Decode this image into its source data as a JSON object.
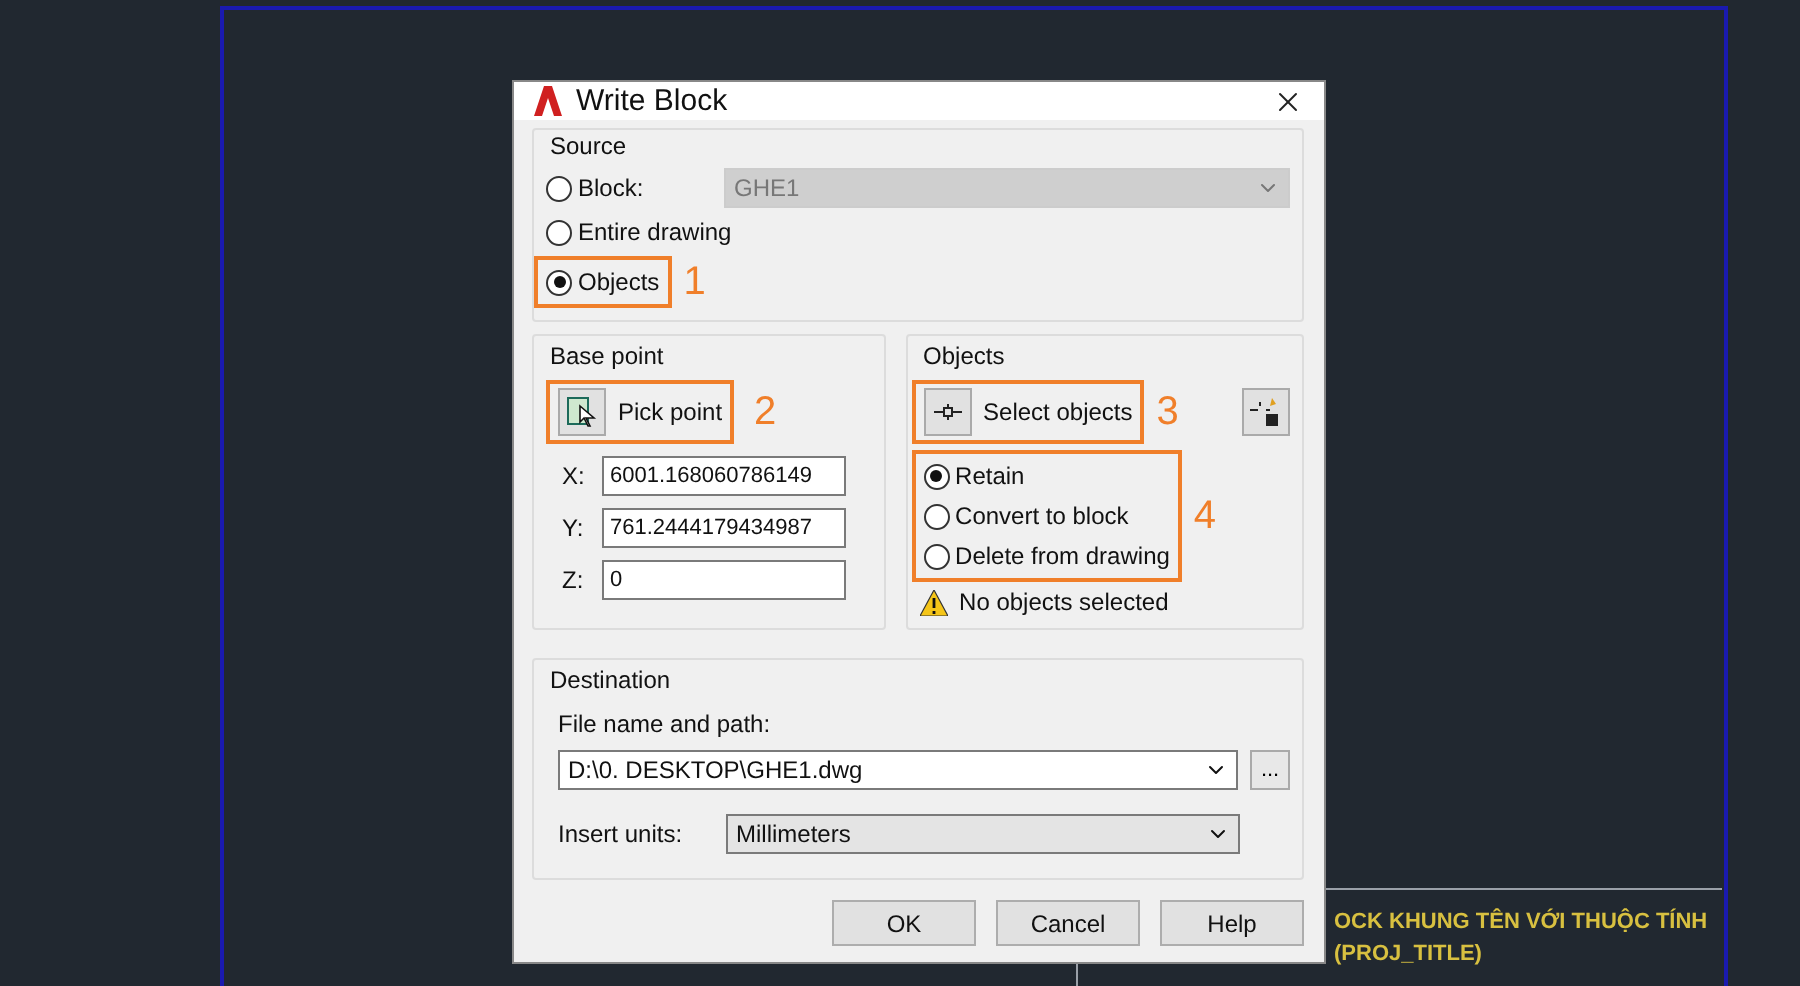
{
  "window": {
    "title": "Write Block"
  },
  "source": {
    "legend": "Source",
    "options": [
      {
        "label": "Block:",
        "selected": false
      },
      {
        "label": "Entire drawing",
        "selected": false
      },
      {
        "label": "Objects",
        "selected": true
      }
    ],
    "block_select": {
      "value": "GHE1",
      "disabled": true
    }
  },
  "base_point": {
    "legend": "Base point",
    "pick_button": "Pick point",
    "fields": [
      {
        "label": "X:",
        "value": "6001.168060786149"
      },
      {
        "label": "Y:",
        "value": "761.2444179434987"
      },
      {
        "label": "Z:",
        "value": "0"
      }
    ]
  },
  "objects": {
    "legend": "Objects",
    "select_button": "Select objects",
    "options": [
      {
        "label": "Retain",
        "selected": true
      },
      {
        "label": "Convert to block",
        "selected": false
      },
      {
        "label": "Delete from drawing",
        "selected": false
      }
    ],
    "warning": "No objects selected"
  },
  "destination": {
    "legend": "Destination",
    "file_label": "File name and path:",
    "file_value": "D:\\0. DESKTOP\\GHE1.dwg",
    "browse_button": "...",
    "units_label": "Insert units:",
    "units_value": "Millimeters"
  },
  "buttons": [
    "OK",
    "Cancel",
    "Help"
  ],
  "annotations": [
    "1",
    "2",
    "3",
    "4"
  ],
  "background_text": [
    "OCK KHUNG TÊN VỚI THUỘC TÍNH",
    "(PROJ_TITLE)"
  ]
}
